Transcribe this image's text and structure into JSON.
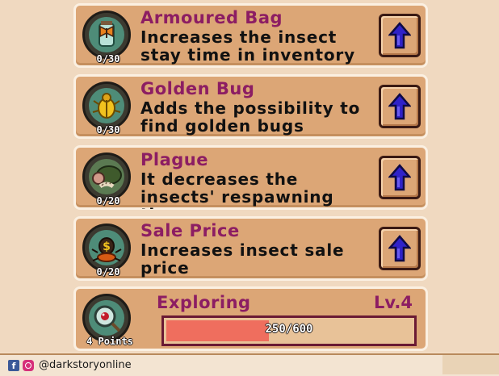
{
  "upgrades": [
    {
      "title": "Armoured Bag",
      "desc": "Increases the insect stay time in inventory",
      "count": "0/30",
      "icon": "butterfly-jar-icon",
      "button_icon": "up-arrow-icon"
    },
    {
      "title": "Golden Bug",
      "desc": "Adds the possibility to find golden bugs",
      "count": "0/30",
      "icon": "golden-beetle-icon",
      "button_icon": "up-arrow-icon"
    },
    {
      "title": "Plague",
      "desc": "It decreases the insects' respawning time",
      "count": "0/20",
      "icon": "larva-on-leaf-icon",
      "button_icon": "up-arrow-icon"
    },
    {
      "title": "Sale Price",
      "desc": "Increases insect sale price",
      "count": "0/20",
      "icon": "money-bug-icon",
      "button_icon": "up-arrow-icon"
    }
  ],
  "exploring": {
    "title": "Exploring",
    "level": "Lv.4",
    "progress_text": "250/600",
    "progress_fraction": 0.4167,
    "points": "4 Points",
    "icon": "magnifier-icon"
  },
  "footer": {
    "handle": "@darkstoryonline",
    "icons": [
      "facebook-icon",
      "instagram-icon"
    ]
  },
  "colors": {
    "panel": "#dca676",
    "title": "#8c1d63",
    "button_arrow": "#2f22c8",
    "progress_fill": "#ef6e5e"
  }
}
